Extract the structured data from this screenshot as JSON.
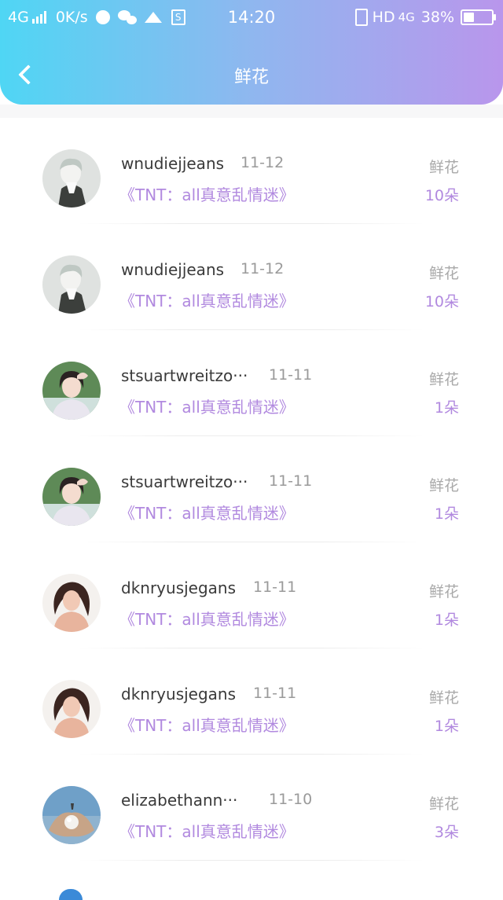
{
  "status_bar": {
    "network": "4G",
    "speed": "0K/s",
    "time": "14:20",
    "right_network": "HD",
    "right_network2": "4G",
    "battery": "38%",
    "battery_level": 0.38
  },
  "header": {
    "title": "鲜花",
    "back_icon": "chevron-left-icon"
  },
  "colors": {
    "gradient_start": "#4fd6f4",
    "gradient_end": "#b996ec",
    "accent": "#b189df"
  },
  "list": {
    "items": [
      {
        "username": "wnudiejjeans",
        "date": "11-12",
        "book": "《TNT：all真意乱情迷》",
        "gift_label": "鲜花",
        "gift_count": "10朵"
      },
      {
        "username": "wnudiejjeans",
        "date": "11-12",
        "book": "《TNT：all真意乱情迷》",
        "gift_label": "鲜花",
        "gift_count": "10朵"
      },
      {
        "username": "stsuartwreitzo···",
        "date": "11-11",
        "book": "《TNT：all真意乱情迷》",
        "gift_label": "鲜花",
        "gift_count": "1朵"
      },
      {
        "username": "stsuartwreitzo···",
        "date": "11-11",
        "book": "《TNT：all真意乱情迷》",
        "gift_label": "鲜花",
        "gift_count": "1朵"
      },
      {
        "username": "dknryusjegans",
        "date": "11-11",
        "book": "《TNT：all真意乱情迷》",
        "gift_label": "鲜花",
        "gift_count": "1朵"
      },
      {
        "username": "dknryusjegans",
        "date": "11-11",
        "book": "《TNT：all真意乱情迷》",
        "gift_label": "鲜花",
        "gift_count": "1朵"
      },
      {
        "username": "elizabethann···",
        "date": "11-10",
        "book": "《TNT：all真意乱情迷》",
        "gift_label": "鲜花",
        "gift_count": "3朵"
      }
    ]
  }
}
